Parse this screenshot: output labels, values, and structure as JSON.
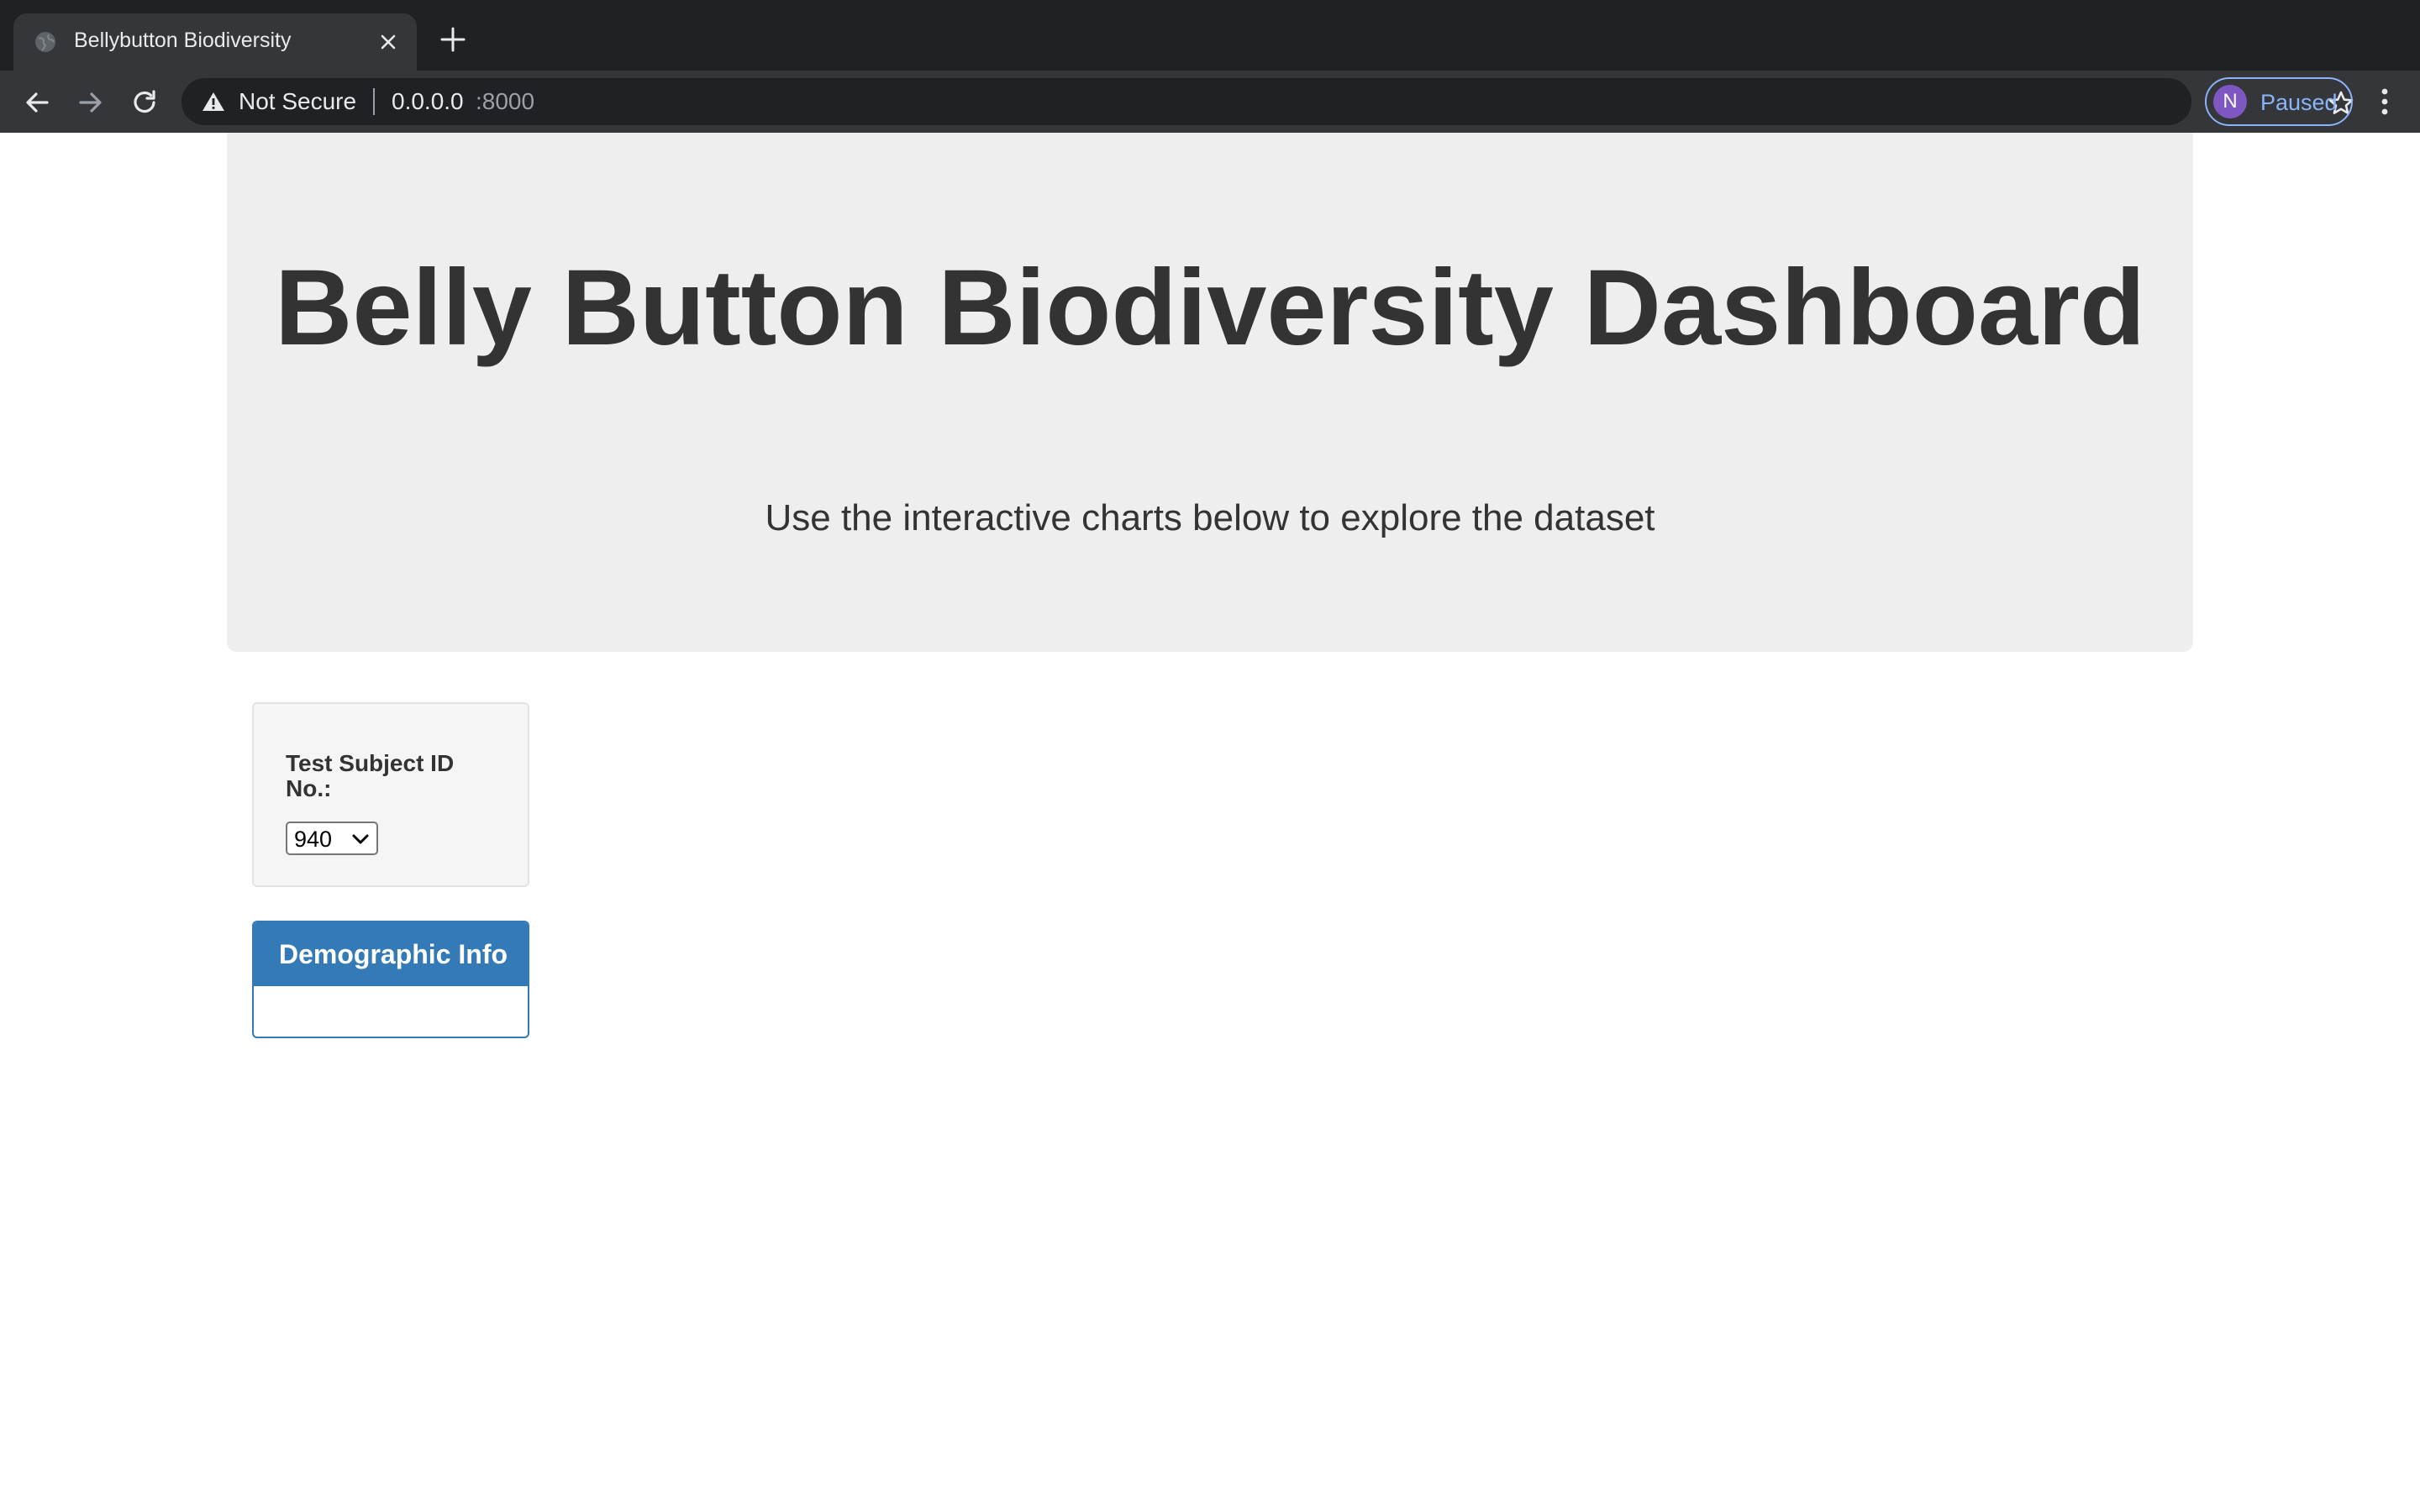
{
  "browser": {
    "tab": {
      "title": "Bellybutton Biodiversity",
      "favicon": "globe-icon"
    },
    "new_tab_icon": "plus-icon",
    "nav": {
      "back_icon": "arrow-left-icon",
      "forward_icon": "arrow-right-icon",
      "reload_icon": "reload-icon"
    },
    "omnibox": {
      "security_icon": "warning-triangle-icon",
      "security_label": "Not Secure",
      "host": "0.0.0.0",
      "port": ":8000"
    },
    "bookmark_icon": "star-icon",
    "profile": {
      "initial": "N",
      "status": "Paused"
    },
    "menu_icon": "kebab-menu-icon"
  },
  "page": {
    "jumbotron": {
      "title": "Belly Button Biodiversity Dashboard",
      "subtitle": "Use the interactive charts below to explore the dataset"
    },
    "selector": {
      "label": "Test Subject ID No.:",
      "selected_value": "940"
    },
    "demographics": {
      "title": "Demographic Info"
    }
  },
  "colors": {
    "chrome_dark": "#202124",
    "chrome_tab": "#35363a",
    "jumbotron_bg": "#eeeeee",
    "panel_primary": "#337ab7",
    "profile_accent": "#8ab4f8",
    "avatar_bg": "#7e57c2"
  }
}
